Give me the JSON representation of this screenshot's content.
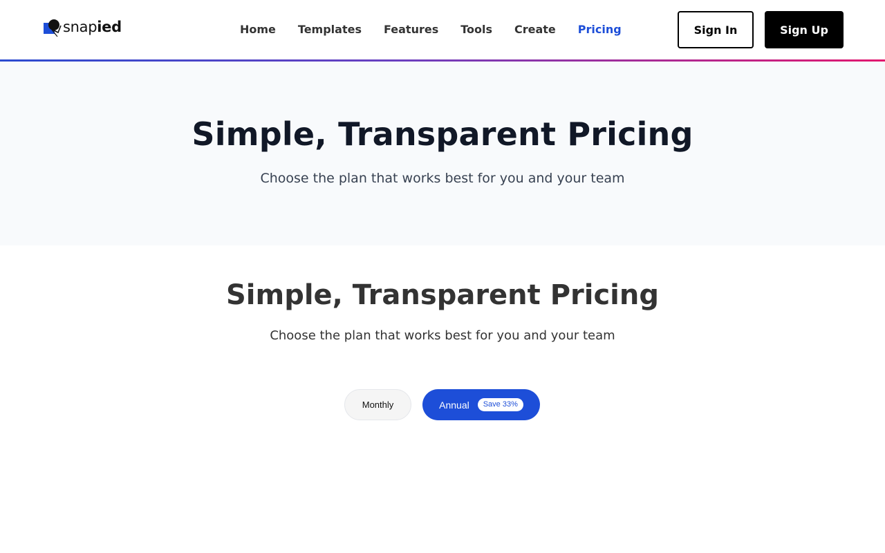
{
  "header": {
    "logo": {
      "text_regular": "snap",
      "text_bold": "ied"
    },
    "nav": [
      {
        "label": "Home",
        "active": false
      },
      {
        "label": "Templates",
        "active": false
      },
      {
        "label": "Features",
        "active": false
      },
      {
        "label": "Tools",
        "active": false
      },
      {
        "label": "Create",
        "active": false
      },
      {
        "label": "Pricing",
        "active": true
      }
    ],
    "sign_in_label": "Sign In",
    "sign_up_label": "Sign Up"
  },
  "hero": {
    "title": "Simple, Transparent Pricing",
    "subtitle": "Choose the plan that works best for you and your team"
  },
  "pricing": {
    "title": "Simple, Transparent Pricing",
    "subtitle": "Choose the plan that works best for you and your team",
    "billing_toggle": {
      "monthly_label": "Monthly",
      "annual_label": "Annual",
      "annual_badge": "Save 33%",
      "selected": "Annual"
    }
  },
  "colors": {
    "accent": "#1d4ed8",
    "brand_dark": "#000000",
    "hero_bg": "#f8fafc",
    "rule_start": "#2b4bd0",
    "rule_end": "#e2176e"
  }
}
